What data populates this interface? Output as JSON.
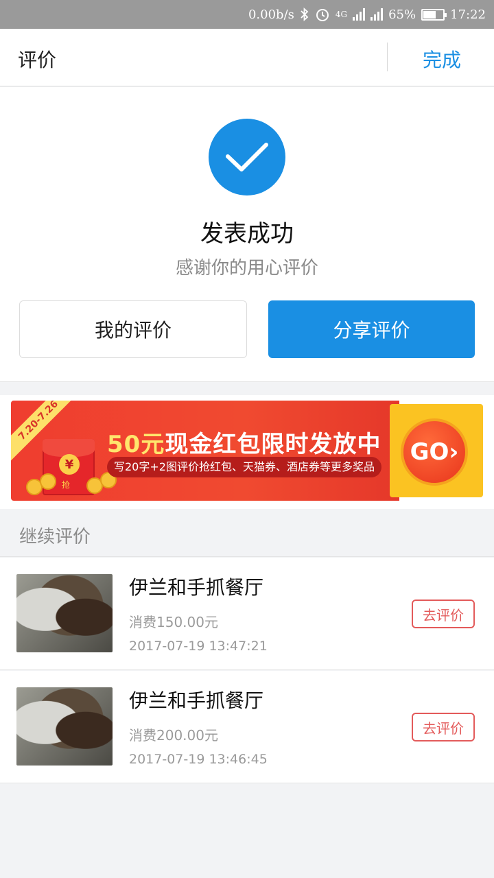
{
  "status_bar": {
    "network_speed": "0.00b/s",
    "network_type": "4G",
    "battery_percent": "65%",
    "battery_level": 0.65,
    "time": "17:22",
    "icons": [
      "bluetooth-icon",
      "alarm-icon",
      "signal-icon",
      "signal-icon",
      "battery-icon"
    ]
  },
  "nav": {
    "title": "评价",
    "done_label": "完成",
    "accent_color": "#1a8fe3"
  },
  "success": {
    "icon": "check-circle-icon",
    "title": "发表成功",
    "subtitle": "感谢你的用心评价",
    "my_reviews_label": "我的评价",
    "share_label": "分享评价"
  },
  "banner": {
    "date_range": "7.20-7.26",
    "headline_highlight": "50元",
    "headline_rest": "现金红包限时发放中",
    "subtext": "写20字+2图评价抢红包、天猫券、酒店券等更多奖品",
    "go_label": "GO›",
    "envelope_symbol": "¥",
    "envelope_tag": "抢",
    "colors": {
      "red": "#ef3d2f",
      "yellow": "#fbc322"
    }
  },
  "continue": {
    "heading": "继续评价",
    "items": [
      {
        "name": "伊兰和手抓餐厅",
        "spend": "消费150.00元",
        "time": "2017-07-19 13:47:21",
        "button": "去评价"
      },
      {
        "name": "伊兰和手抓餐厅",
        "spend": "消费200.00元",
        "time": "2017-07-19 13:46:45",
        "button": "去评价"
      }
    ]
  }
}
